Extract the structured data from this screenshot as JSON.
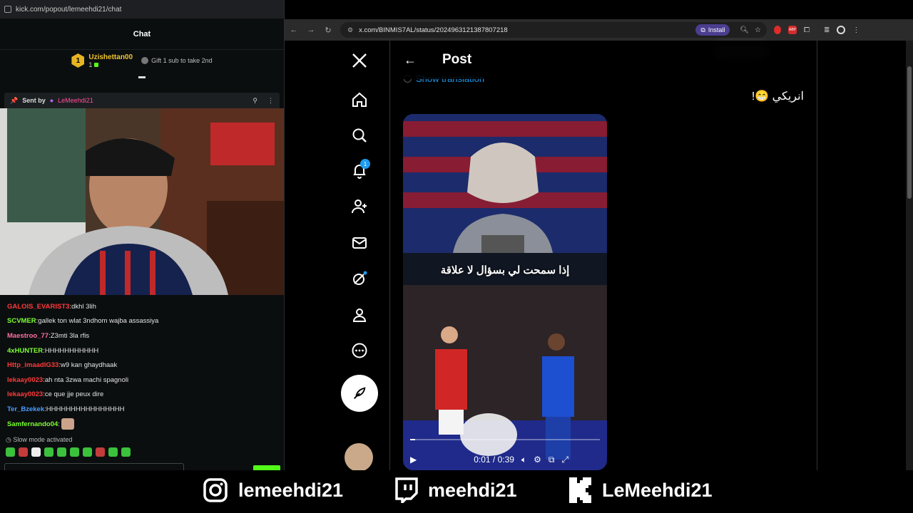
{
  "kick": {
    "url": "kick.com/popout/lemeehdi21/chat",
    "header_title": "Chat",
    "top_gifter": {
      "rank": "1",
      "name": "Uzishettan00",
      "count": "1",
      "gift_text": "Gift 1 sub to take 2nd"
    },
    "pinned": {
      "sent_by_label": "Sent by",
      "sender": "LeMeehdi21"
    },
    "messages": [
      {
        "user": "GALOIS_EVARIST3",
        "color": "#ff3b3b",
        "text": "dkhl 3lih"
      },
      {
        "user": "SCVMER",
        "color": "#7dff33",
        "text": "gallek ton wlat 3ndhom wajba assassiya"
      },
      {
        "user": "Maestroo_77",
        "color": "#ff6fa0",
        "text": "Z3mti 3la rfis"
      },
      {
        "user": "4xHUNTER",
        "color": "#7dff33",
        "text": "HHHHHHHHHHH"
      },
      {
        "user": "Http_imaadIG33",
        "color": "#ff3b3b",
        "text": "w9 kan ghaydhaak"
      },
      {
        "user": "lekaay0023",
        "color": "#ff3b3b",
        "text": "ah nta 3zwa machi spagnoli"
      },
      {
        "user": "lekaay0023",
        "color": "#ff3b3b",
        "text": "ce que jje peux dire"
      },
      {
        "user": "Ter_Bzekek",
        "color": "#4a9dff",
        "text": "HHHHHHHHHHHHHHHH"
      },
      {
        "user": "Samfernando04",
        "color": "#7dff33",
        "text": ""
      }
    ],
    "slow_mode": "Slow mode activated"
  },
  "browser": {
    "url": "x.com/BINMIS7AL/status/2024963121387807218",
    "install_label": "Install"
  },
  "x": {
    "post_title": "Post",
    "show_translation": "Show translation",
    "tweet_text": "انريكي 😁!",
    "notif_count": "1",
    "video": {
      "caption": "إذا سمحت لي بسؤال لا علاقة",
      "time": "0:01 / 0:39",
      "progress": 0.026
    }
  },
  "social": [
    {
      "icon": "instagram-icon",
      "handle": "lemeehdi21"
    },
    {
      "icon": "twitch-icon",
      "handle": "meehdi21"
    },
    {
      "icon": "kick-icon",
      "handle": "LeMeehdi21"
    }
  ]
}
